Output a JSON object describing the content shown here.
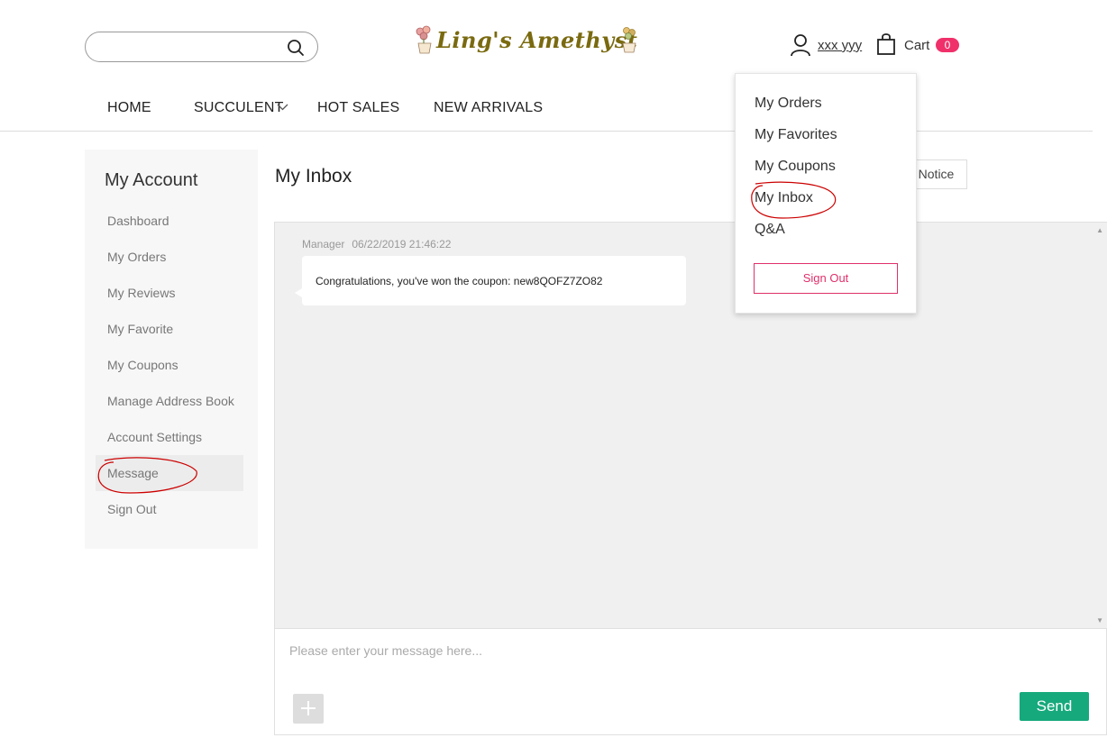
{
  "header": {
    "search": {
      "placeholder": "",
      "icon": "search-icon"
    },
    "logo_text": "Ling's Amethyst",
    "user_name": "xxx yyy",
    "cart": {
      "label": "Cart",
      "count": "0"
    }
  },
  "nav": {
    "items": [
      {
        "label": "HOME"
      },
      {
        "label": "SUCCULENT",
        "has_dropdown": true
      },
      {
        "label": "HOT SALES"
      },
      {
        "label": "NEW ARRIVALS"
      }
    ]
  },
  "sidebar": {
    "title": "My Account",
    "items": [
      {
        "label": "Dashboard"
      },
      {
        "label": "My Orders"
      },
      {
        "label": "My Reviews"
      },
      {
        "label": "My Favorite"
      },
      {
        "label": "My Coupons"
      },
      {
        "label": "Manage Address Book"
      },
      {
        "label": "Account Settings"
      },
      {
        "label": "Message",
        "active": true
      },
      {
        "label": "Sign Out"
      }
    ]
  },
  "main": {
    "title": "My Inbox",
    "notice_button": "Notice",
    "messages": [
      {
        "sender": "Manager",
        "timestamp": "06/22/2019 21:46:22",
        "text": "Congratulations, you've won the coupon: new8QOFZ7ZO82"
      }
    ],
    "compose": {
      "placeholder": "Please enter your message here...",
      "send_label": "Send"
    }
  },
  "account_dropdown": {
    "items": [
      {
        "label": "My Orders"
      },
      {
        "label": "My Favorites"
      },
      {
        "label": "My Coupons"
      },
      {
        "label": "My Inbox"
      },
      {
        "label": "Q&A"
      }
    ],
    "sign_out_label": "Sign Out"
  },
  "colors": {
    "accent_pink": "#f0306a",
    "send_green": "#16a97b",
    "logo_olive": "#7a6a10",
    "annotation_red": "#cc0000"
  }
}
